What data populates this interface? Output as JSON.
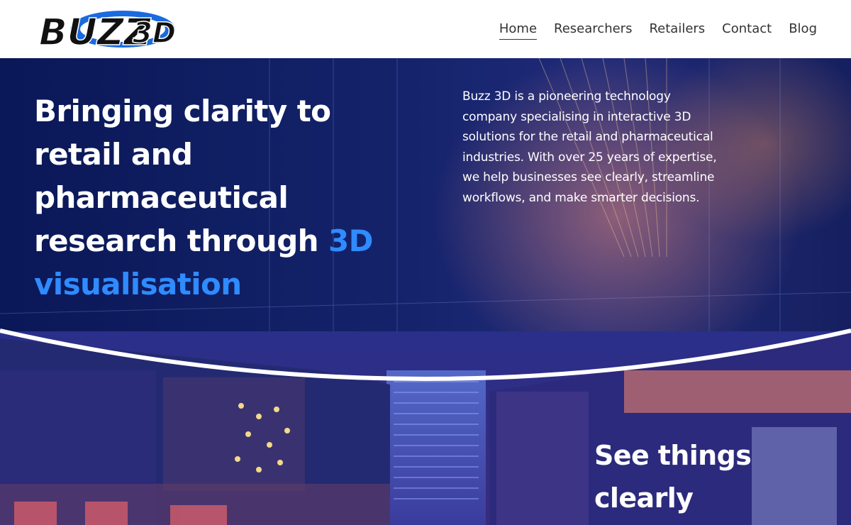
{
  "header": {
    "logo": {
      "text": "BUZZ",
      "mark": "3D",
      "alt": "Buzz 3D logo"
    },
    "nav": [
      {
        "label": "Home",
        "active": true
      },
      {
        "label": "Researchers",
        "active": false
      },
      {
        "label": "Retailers",
        "active": false
      },
      {
        "label": "Contact",
        "active": false
      },
      {
        "label": "Blog",
        "active": false
      }
    ]
  },
  "hero": {
    "headline_part1": "Bringing clarity to retail and pharmaceutical research through",
    "headline_accent": "3D visualisation",
    "intro": "Buzz 3D is a pioneering technology company specialising in interactive 3D solutions for the retail and pharmaceutical industries. With over 25 years of expertise, we help businesses see clearly, streamline workflows, and make smarter decisions.",
    "subheading": "See things clearly"
  },
  "colors": {
    "header_bg": "#ffffff",
    "nav_text": "#333333",
    "hero_navy": "#0d1a5c",
    "accent_blue": "#2f8bff",
    "divider": "#ffffff"
  }
}
